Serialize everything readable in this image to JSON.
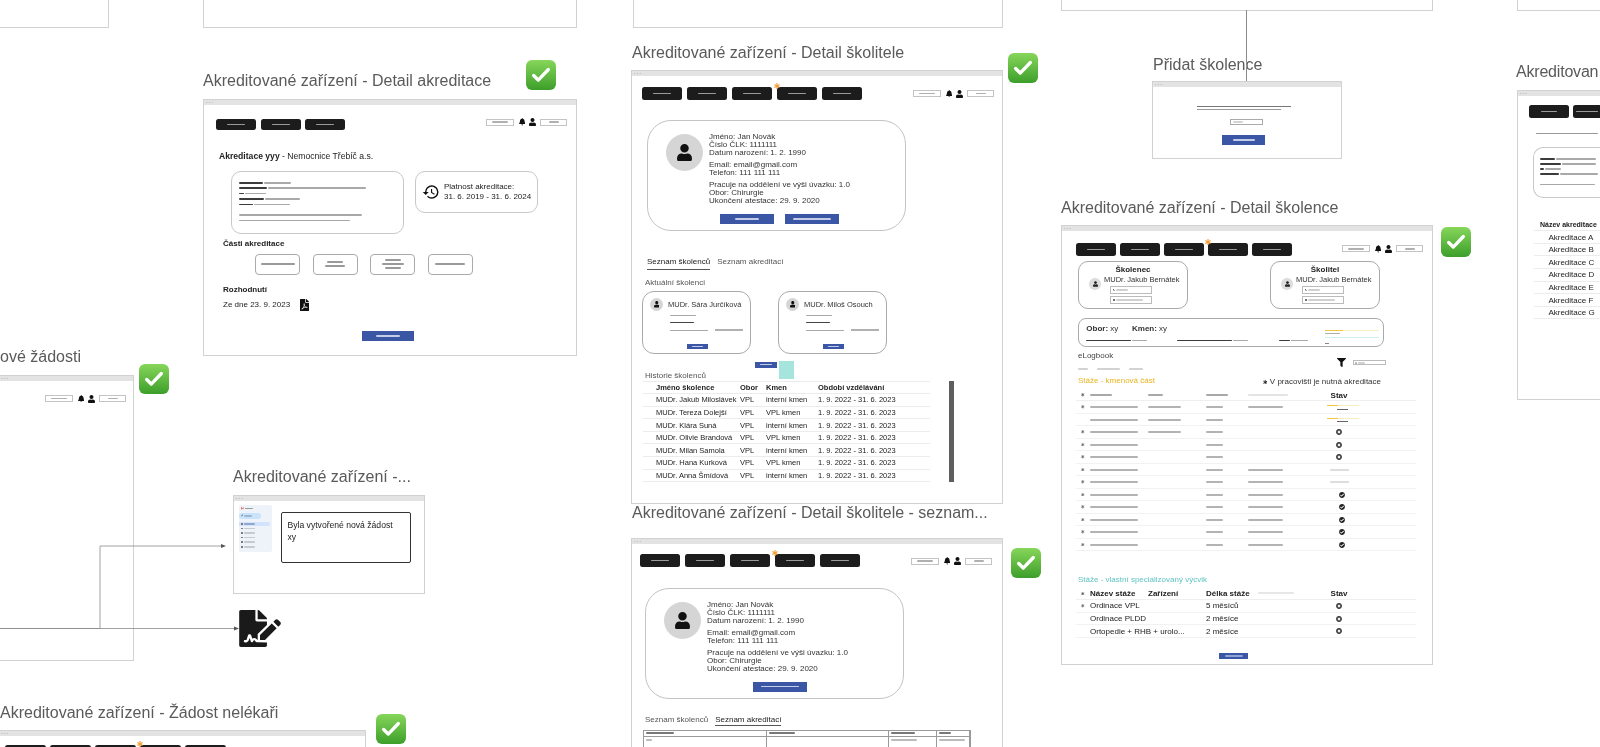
{
  "frames": [
    {
      "kind": "blank"
    },
    {
      "kind": "blank"
    },
    {
      "kind": "blank"
    },
    {
      "kind": "blank"
    },
    {
      "kind": "blank"
    },
    {
      "kind": "accreditation_detail",
      "title": "Akreditované zařízení - Detail akreditace",
      "approved": true,
      "nav": [
        {
          "marked": false
        },
        {
          "marked": false
        },
        {
          "marked": false
        }
      ],
      "heading": "**Akreditace yyy** - Nemocnice Třebíč a.s.",
      "validity": {
        "label": "Platnost akreditace:",
        "dates": "31. 6. 2019 - 31. 6. 2024"
      },
      "parts_title": "Části akreditace",
      "decision_title": "Rozhodnutí",
      "decision_date": "Ze dne 23. 9. 2023"
    },
    {
      "kind": "trainer_detail",
      "title": "Akreditované zařízení - Detail školitele",
      "approved": true,
      "nav": [
        {
          "marked": false
        },
        {
          "marked": false
        },
        {
          "marked": false
        },
        {
          "marked": true
        },
        {
          "marked": false
        }
      ],
      "profile": [
        [
          "Jméno: Jan Novák",
          "Číslo ČLK: 1111111",
          "Datum narození: 1. 2. 1990"
        ],
        [
          "Email: email@gmail.com",
          "Telefon: 111 111 111"
        ],
        [
          "Pracuje na oddělení ve výši úvazku: 1.0",
          "Obor: Chirurgie",
          "Ukončení atestace: 29. 9. 2020"
        ]
      ],
      "tabs": [
        {
          "label": "Seznam školenců",
          "selected": true
        },
        {
          "label": "Seznam akreditací",
          "selected": false
        }
      ],
      "current_title": "Aktuální školenci",
      "trainees": [
        {
          "name": "MUDr. Sára Jurčíková"
        },
        {
          "name": "MUDr. Miloš Osouch"
        }
      ],
      "history_title": "Historie školenců",
      "table": {
        "columns": [
          "Jméno školence",
          "Obor",
          "Kmen",
          "Období vzdělávání"
        ],
        "rows": [
          [
            "MUDr. Jakub Miloslávek",
            "VPL",
            "interní kmen",
            "1. 9. 2022 - 31. 6. 2023"
          ],
          [
            "MUDr. Tereza Dolejší",
            "VPL",
            "VPL kmen",
            "1. 9. 2022 - 31. 6. 2023"
          ],
          [
            "MUDr. Klára Suná",
            "VPL",
            "interní kmen",
            "1. 9. 2022 - 31. 6. 2023"
          ],
          [
            "MUDr. Olivie Brandová",
            "VPL",
            "VPL kmen",
            "1. 9. 2022 - 31. 6. 2023"
          ],
          [
            "MUDr. Milan Samola",
            "VPL",
            "interní kmen",
            "1. 9. 2022 - 31. 6. 2023"
          ],
          [
            "MUDr. Hana Kurková",
            "VPL",
            "VPL kmen",
            "1. 9. 2022 - 31. 6. 2023"
          ],
          [
            "MUDr. Anna Šmídová",
            "VPL",
            "interní kmen",
            "1. 9. 2022 - 31. 6. 2023"
          ]
        ]
      }
    },
    {
      "kind": "add_trainee",
      "title": "Přidat školence",
      "approved": false
    },
    {
      "kind": "facility_cut",
      "title": "Akreditovan",
      "table": {
        "columns": [
          "Název akreditace"
        ],
        "rows": [
          [
            "Akreditace A"
          ],
          [
            "Akreditace B"
          ],
          [
            "Akreditace C"
          ],
          [
            "Akreditace D"
          ],
          [
            "Akreditace E"
          ],
          [
            "Akreditace F"
          ],
          [
            "Akreditace G"
          ]
        ]
      }
    },
    {
      "kind": "trainee_detail",
      "title": "Akreditované zařízení - Detail školence",
      "approved": true,
      "nav": [
        {
          "marked": false
        },
        {
          "marked": false
        },
        {
          "marked": false
        },
        {
          "marked": true
        },
        {
          "marked": false
        }
      ],
      "people": [
        {
          "role": "Školenec",
          "name": "MUDr. Jakub Bernátek"
        },
        {
          "role": "Školitel",
          "name": "MUDr. Jakub Bernátek"
        }
      ],
      "summary": {
        "field": "**Obor:** xy",
        "core": "**Kmen:** xy",
        "level": 0.34
      },
      "logbook_title": "eLogbook",
      "legend": "V pracovišti je nutná akreditace",
      "core_section": {
        "title": "Stáže - kmenová část",
        "status_header": "Stav",
        "rows": [
          {
            "marked": true,
            "has_facility": true,
            "has_period": true,
            "kind": "progress",
            "level": 0.33
          },
          {
            "marked": false,
            "has_facility": true,
            "has_period": false,
            "kind": "progress",
            "level": 0.33
          },
          {
            "marked": true,
            "has_facility": true,
            "has_period": false,
            "kind": "rejected"
          },
          {
            "marked": true,
            "has_facility": false,
            "has_period": false,
            "kind": "rejected"
          },
          {
            "marked": true,
            "has_facility": false,
            "has_period": false,
            "kind": "rejected"
          },
          {
            "marked": true,
            "has_facility": false,
            "has_period": true,
            "kind": "pending"
          },
          {
            "marked": true,
            "has_facility": false,
            "has_period": true,
            "kind": "pending"
          },
          {
            "marked": true,
            "has_facility": false,
            "has_period": true,
            "kind": "done"
          },
          {
            "marked": true,
            "has_facility": false,
            "has_period": true,
            "kind": "done"
          },
          {
            "marked": true,
            "has_facility": false,
            "has_period": true,
            "kind": "done"
          },
          {
            "marked": true,
            "has_facility": false,
            "has_period": true,
            "kind": "done"
          },
          {
            "marked": true,
            "has_facility": false,
            "has_period": true,
            "kind": "done"
          }
        ]
      },
      "own_section": {
        "title": "Stáže - vlastní specializovaný výcvik",
        "columns": [
          "Název stáže",
          "Zařízení",
          "Délka stáže",
          "Stav"
        ],
        "rows": [
          {
            "name": "Ordinace VPL",
            "length": "5 měsíců",
            "marked": true,
            "kind": "rejected"
          },
          {
            "name": "Ordinace PLDD",
            "length": "2 měsíce",
            "marked": false,
            "kind": "rejected"
          },
          {
            "name": "Ortopedie + RHB + urolo...",
            "length": "2 měsíce",
            "marked": false,
            "kind": "rejected"
          }
        ]
      }
    },
    {
      "kind": "requests_cut",
      "title": "ové žádosti",
      "approved": true
    },
    {
      "kind": "email",
      "title": "Akreditované zařízení -...",
      "approved": false,
      "menu": [
        {
          "selected": true
        },
        {
          "selected": false
        },
        {
          "selected": false
        },
        {
          "selected": false
        },
        {
          "selected": false
        },
        {
          "selected": false
        }
      ],
      "message": "Byla vytvořené nová žádost xy"
    },
    {
      "kind": "trainer_accreditations",
      "title": "Akreditované zařízení - Detail školitele - seznam...",
      "approved": true,
      "nav": [
        {
          "marked": false
        },
        {
          "marked": false
        },
        {
          "marked": false
        },
        {
          "marked": true
        },
        {
          "marked": false
        }
      ],
      "profile": [
        [
          "Jméno: Jan Novák",
          "Číslo ČLK: 1111111",
          "Datum narození: 1. 2. 1990"
        ],
        [
          "Email: email@gmail.com",
          "Telefon: 111 111 111"
        ],
        [
          "Pracuje na oddělení ve výši úvazku: 1.0",
          "Obor: Chirurgie",
          "Ukončení atestace: 29. 9. 2020"
        ]
      ],
      "tabs": [
        {
          "label": "Seznam školenců",
          "selected": false
        },
        {
          "label": "Seznam akreditací",
          "selected": true
        }
      ]
    },
    {
      "kind": "request_form_cut",
      "title": "Akreditované zařízení - Žádost nelékaři",
      "approved": true,
      "nav": [
        {
          "marked": false
        },
        {
          "marked": false
        },
        {
          "marked": false
        },
        {
          "marked": true
        },
        {
          "marked": false
        }
      ]
    }
  ]
}
